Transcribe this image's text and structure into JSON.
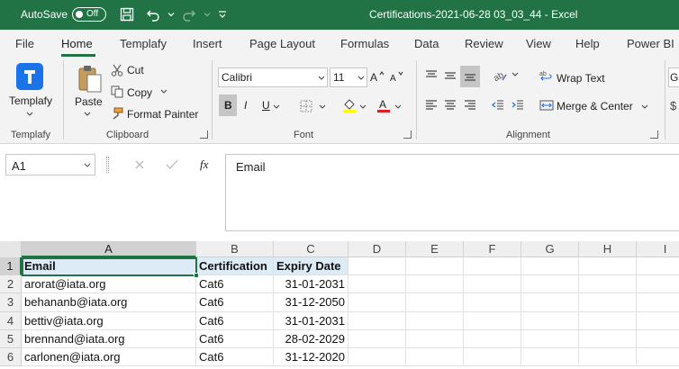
{
  "titlebar": {
    "autosave_label": "AutoSave",
    "autosave_state": "Off",
    "document_title": "Certifications-2021-06-28 03_03_44  -  Excel"
  },
  "tabs": [
    "File",
    "Home",
    "Templafy",
    "Insert",
    "Page Layout",
    "Formulas",
    "Data",
    "Review",
    "View",
    "Help",
    "Power BI"
  ],
  "active_tab": "Home",
  "ribbon": {
    "templafy": {
      "button": "Templafy",
      "group": "Templafy"
    },
    "clipboard": {
      "paste": "Paste",
      "cut": "Cut",
      "copy": "Copy",
      "format_painter": "Format Painter",
      "group": "Clipboard"
    },
    "font": {
      "name": "Calibri",
      "size": "11",
      "bold": "B",
      "italic": "I",
      "underline": "U",
      "group": "Font"
    },
    "alignment": {
      "wrap_text": "Wrap Text",
      "merge_center": "Merge & Center",
      "group": "Alignment"
    },
    "number_partial": "G"
  },
  "formula_bar": {
    "name_box": "A1",
    "fx": "fx",
    "value": "Email"
  },
  "grid": {
    "columns": [
      "A",
      "B",
      "C",
      "D",
      "E",
      "F",
      "G",
      "H",
      "I"
    ],
    "rows": [
      "1",
      "2",
      "3",
      "4",
      "5",
      "6"
    ],
    "header": [
      "Email",
      "Certification",
      "Expiry Date"
    ],
    "data": [
      [
        "arorat@iata.org",
        "Cat6",
        "31-01-2031"
      ],
      [
        "behananb@iata.org",
        "Cat6",
        "31-12-2050"
      ],
      [
        "bettiv@iata.org",
        "Cat6",
        "31-01-2031"
      ],
      [
        "brennand@iata.org",
        "Cat6",
        "28-02-2029"
      ],
      [
        "carlonen@iata.org",
        "Cat6",
        "31-12-2020"
      ]
    ]
  },
  "colors": {
    "brand_green": "#217346",
    "header_fill": "#ddebf7"
  }
}
